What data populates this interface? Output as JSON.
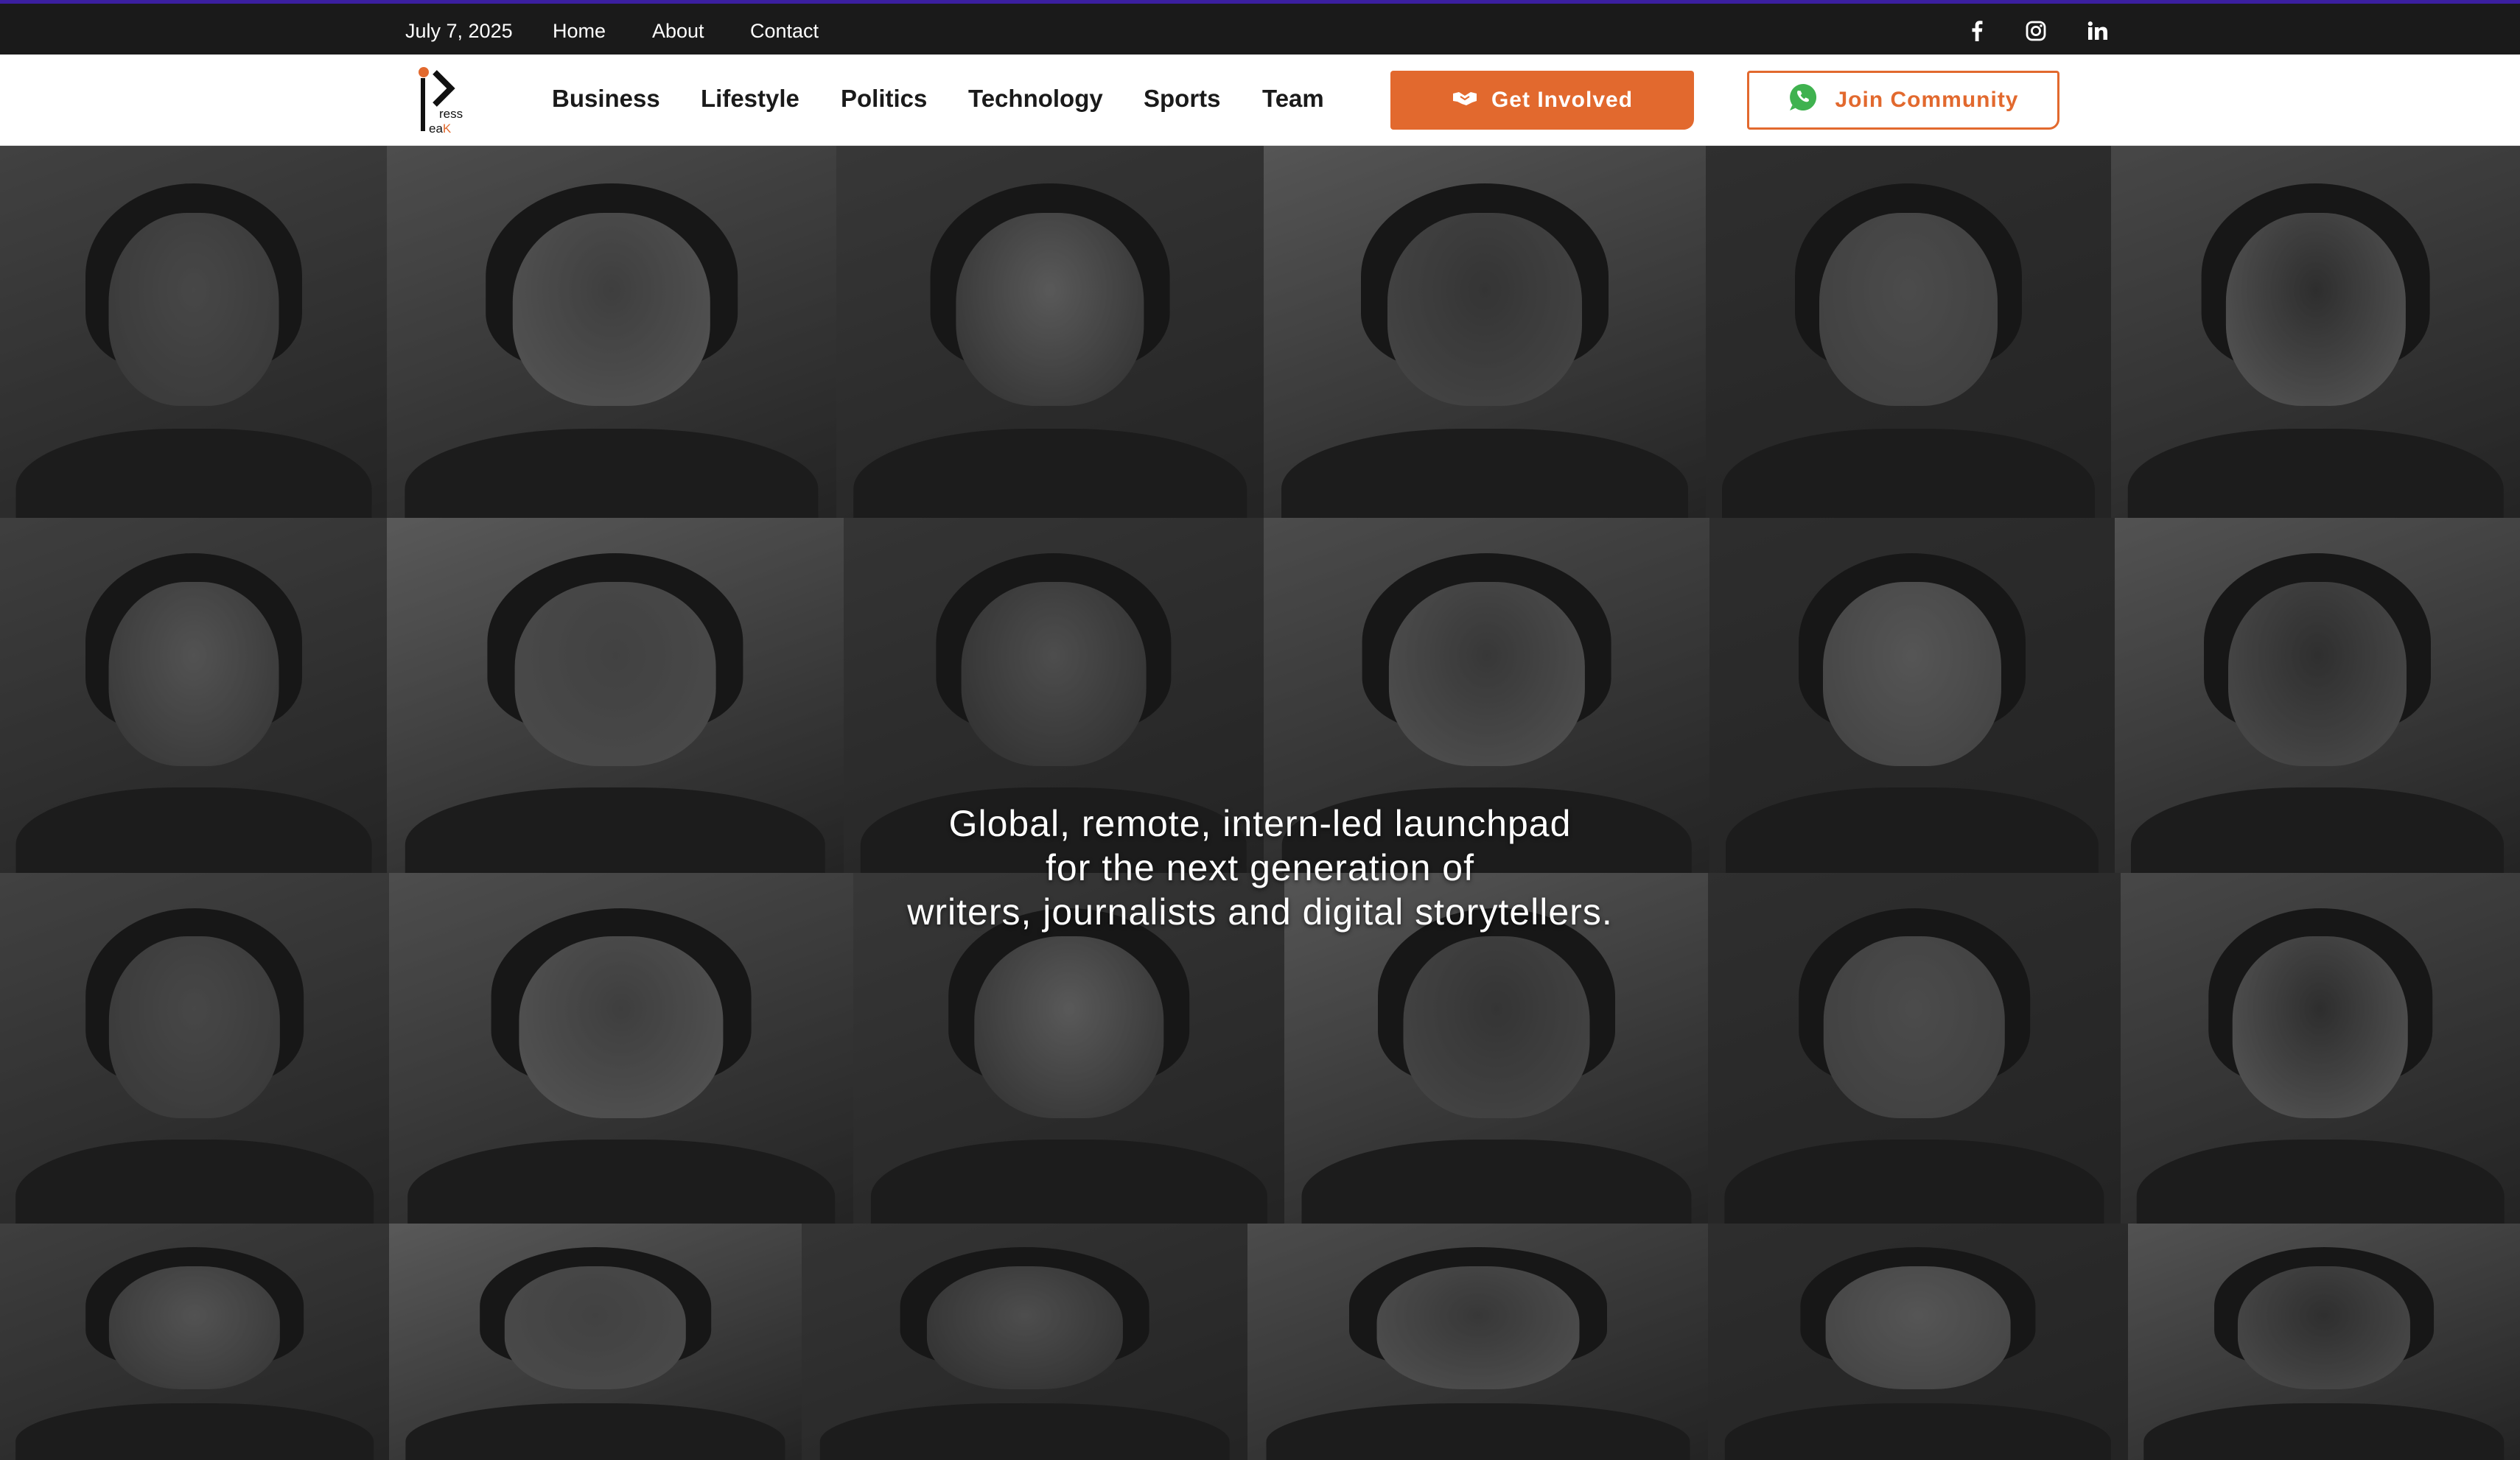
{
  "topbar": {
    "date": "July 7, 2025",
    "links": [
      "Home",
      "About",
      "Contact"
    ],
    "social": [
      "facebook-icon",
      "instagram-icon",
      "linkedin-icon"
    ]
  },
  "logo": {
    "letters_top": "ress",
    "letters_bottom": "eaK"
  },
  "nav": {
    "items": [
      "Business",
      "Lifestyle",
      "Politics",
      "Technology",
      "Sports",
      "Team"
    ],
    "get_involved": "Get Involved",
    "join_community": "Join Community"
  },
  "hero": {
    "tagline": [
      "Global, remote, intern-led launchpad",
      "for the next generation of",
      "writers, journalists and digital storytellers."
    ]
  },
  "colors": {
    "accent": "#e2692e",
    "topbar": "#1a1a1a",
    "topbar_border": "#3b1fa0",
    "whatsapp": "#3fb24f"
  }
}
